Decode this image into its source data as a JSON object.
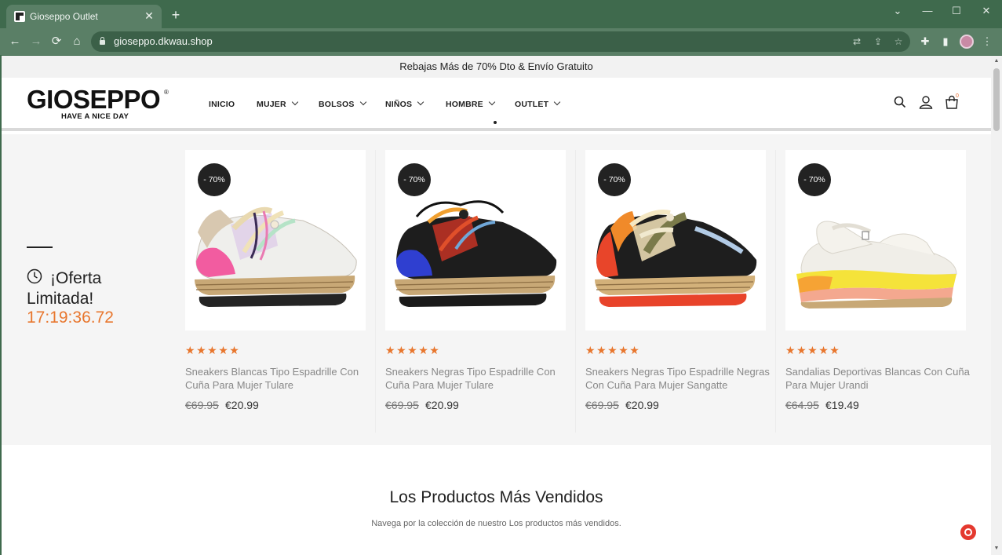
{
  "browser": {
    "tab_title": "Gioseppo Outlet",
    "new_tab_symbol": "+",
    "url": "gioseppo.dkwau.shop"
  },
  "page": {
    "announcement": "Rebajas Más de 70% Dto & Envío Gratuito",
    "logo": {
      "brand": "GIOSEPPO",
      "registered": "®",
      "tagline": "HAVE A NICE DAY"
    },
    "nav": [
      {
        "label": "INICIO",
        "has_dropdown": false
      },
      {
        "label": "MUJER",
        "has_dropdown": true
      },
      {
        "label": "BOLSOS",
        "has_dropdown": true
      },
      {
        "label": "NIÑOS",
        "has_dropdown": true
      },
      {
        "label": "HOMBRE",
        "has_dropdown": true
      },
      {
        "label": "OUTLET",
        "has_dropdown": true
      }
    ],
    "cart_count": "0",
    "offer": {
      "title": "¡Oferta Limitada!",
      "timer": "17:19:36.72"
    },
    "products": [
      {
        "badge": "- 70%",
        "rating": 5,
        "name": "Sneakers Blancas Tipo Espadrille Con Cuña Para Mujer Tulare",
        "old_price": "€69.95",
        "price": "€20.99"
      },
      {
        "badge": "- 70%",
        "rating": 5,
        "name": "Sneakers Negras Tipo Espadrille Con Cuña Para Mujer Tulare",
        "old_price": "€69.95",
        "price": "€20.99"
      },
      {
        "badge": "- 70%",
        "rating": 5,
        "name": "Sneakers Negras Tipo Espadrille Negras Con Cuña Para Mujer Sangatte",
        "old_price": "€69.95",
        "price": "€20.99"
      },
      {
        "badge": "- 70%",
        "rating": 5,
        "name": "Sandalias Deportivas Blancas Con Cuña Para Mujer Urandi",
        "old_price": "€64.95",
        "price": "€19.49"
      }
    ],
    "best_sellers": {
      "title": "Los Productos Más Vendidos",
      "subtitle": "Navega por la colección de nuestro Los productos más vendidos."
    }
  },
  "colors": {
    "browser_frame": "#3f6a4d",
    "accent_orange": "#e8762d",
    "badge_dark": "#222222"
  }
}
